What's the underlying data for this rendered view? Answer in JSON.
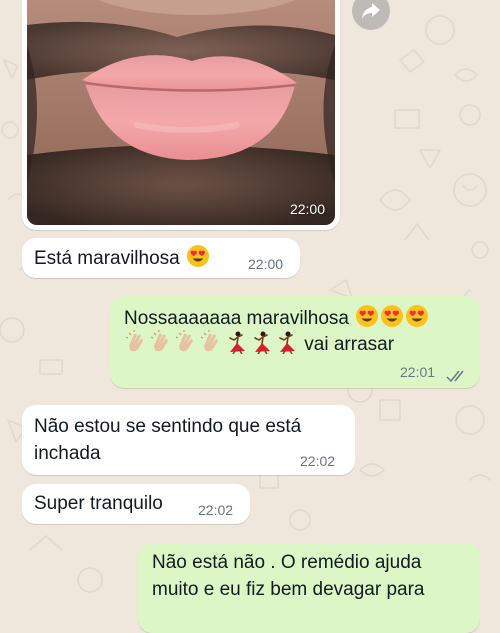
{
  "chat": {
    "image_message": {
      "time": "22:00"
    },
    "messages": [
      {
        "direction": "in",
        "text": "Está maravilhosa",
        "emojis": [
          "heart-eyes"
        ],
        "time": "22:00"
      },
      {
        "direction": "out",
        "line1": "Nossaaaaaaa maravilhosa",
        "line1_emojis": [
          "heart-eyes",
          "heart-eyes",
          "heart-eyes"
        ],
        "line2_emojis": [
          "clapping-hands",
          "clapping-hands",
          "clapping-hands",
          "clapping-hands",
          "dancer",
          "dancer",
          "dancer"
        ],
        "line2_text": "vai arrasar",
        "time": "22:01",
        "status": "read"
      },
      {
        "direction": "in",
        "line1": "Não estou se sentindo que está",
        "line2": "inchada",
        "time": "22:02"
      },
      {
        "direction": "in",
        "text": "Super tranquilo",
        "time": "22:02"
      },
      {
        "direction": "out",
        "line1": "Não está não . O remédio ajuda",
        "line2": "muito e eu fiz bem devagar para"
      }
    ]
  },
  "colors": {
    "wallpaper": "#efe7dc",
    "incoming_bubble": "#ffffff",
    "outgoing_bubble": "#dcf7c5",
    "timestamp": "#667781",
    "read_ticks": "#667781"
  }
}
